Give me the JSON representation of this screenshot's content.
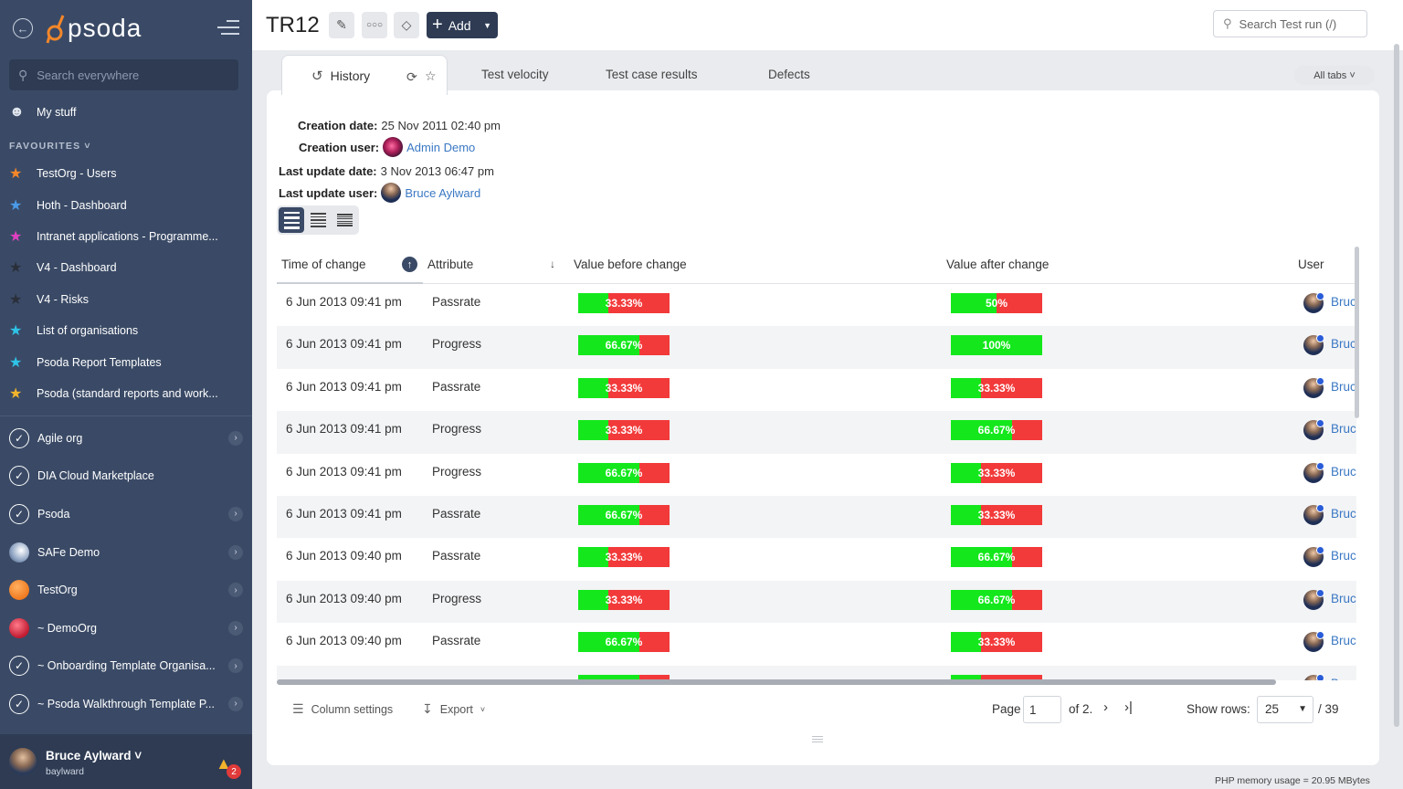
{
  "sidebar": {
    "logo_text": "psoda",
    "search_placeholder": "Search everywhere",
    "my_stuff": "My stuff",
    "favourites_heading": "FAVOURITES",
    "favourites": [
      {
        "label": "TestOrg - Users",
        "color": "#f5872a"
      },
      {
        "label": "Hoth - Dashboard",
        "color": "#4a9ae8"
      },
      {
        "label": "Intranet applications - Programme...",
        "color": "#e040c0"
      },
      {
        "label": "V4 - Dashboard",
        "color": "#2a2f3a"
      },
      {
        "label": "V4 - Risks",
        "color": "#2a2f3a"
      },
      {
        "label": "List of organisations",
        "color": "#2ec4e8"
      },
      {
        "label": "Psoda Report Templates",
        "color": "#2ec4e8"
      },
      {
        "label": "Psoda (standard reports and work...",
        "color": "#f2b42c"
      }
    ],
    "orgs": [
      {
        "label": "Agile org",
        "icon": "check",
        "arrow": true
      },
      {
        "label": "DIA Cloud Marketplace",
        "icon": "check",
        "arrow": false
      },
      {
        "label": "Psoda",
        "icon": "check",
        "arrow": true
      },
      {
        "label": "SAFe Demo",
        "icon": "safe",
        "arrow": true
      },
      {
        "label": "TestOrg",
        "icon": "orange",
        "arrow": true
      },
      {
        "label": "~ DemoOrg",
        "icon": "red",
        "arrow": true
      },
      {
        "label": "~ Onboarding Template Organisa...",
        "icon": "check",
        "arrow": true
      },
      {
        "label": "~ Psoda Walkthrough Template P...",
        "icon": "check",
        "arrow": true
      }
    ],
    "user": {
      "name": "Bruce Aylward",
      "username": "baylward",
      "notifications": "2"
    }
  },
  "header": {
    "title": "TR12",
    "add_label": "Add",
    "search_placeholder": "Search Test run (/)"
  },
  "tabs": {
    "active": "History",
    "others": [
      "Test velocity",
      "Test case results",
      "Defects"
    ],
    "all_tabs": "All tabs"
  },
  "meta": {
    "creation_date_label": "Creation date:",
    "creation_date": "25 Nov 2011 02:40 pm",
    "creation_user_label": "Creation user:",
    "creation_user": "Admin Demo",
    "last_update_date_label": "Last update date:",
    "last_update_date": "3 Nov 2013 06:47 pm",
    "last_update_user_label": "Last update user:",
    "last_update_user": "Bruce Aylward"
  },
  "table": {
    "columns": [
      "Time of change",
      "Attribute",
      "Value before change",
      "Value after change",
      "User"
    ],
    "user_display": "Bruc",
    "rows": [
      {
        "time": "6 Jun 2013 09:41 pm",
        "attribute": "Passrate",
        "before": 33.33,
        "before_label": "33.33%",
        "after": 50,
        "after_label": "50%"
      },
      {
        "time": "6 Jun 2013 09:41 pm",
        "attribute": "Progress",
        "before": 66.67,
        "before_label": "66.67%",
        "after": 100,
        "after_label": "100%"
      },
      {
        "time": "6 Jun 2013 09:41 pm",
        "attribute": "Passrate",
        "before": 33.33,
        "before_label": "33.33%",
        "after": 33.33,
        "after_label": "33.33%"
      },
      {
        "time": "6 Jun 2013 09:41 pm",
        "attribute": "Progress",
        "before": 33.33,
        "before_label": "33.33%",
        "after": 66.67,
        "after_label": "66.67%"
      },
      {
        "time": "6 Jun 2013 09:41 pm",
        "attribute": "Progress",
        "before": 66.67,
        "before_label": "66.67%",
        "after": 33.33,
        "after_label": "33.33%"
      },
      {
        "time": "6 Jun 2013 09:41 pm",
        "attribute": "Passrate",
        "before": 66.67,
        "before_label": "66.67%",
        "after": 33.33,
        "after_label": "33.33%"
      },
      {
        "time": "6 Jun 2013 09:40 pm",
        "attribute": "Passrate",
        "before": 33.33,
        "before_label": "33.33%",
        "after": 66.67,
        "after_label": "66.67%"
      },
      {
        "time": "6 Jun 2013 09:40 pm",
        "attribute": "Progress",
        "before": 33.33,
        "before_label": "33.33%",
        "after": 66.67,
        "after_label": "66.67%"
      },
      {
        "time": "6 Jun 2013 09:40 pm",
        "attribute": "Passrate",
        "before": 66.67,
        "before_label": "66.67%",
        "after": 33.33,
        "after_label": "33.33%"
      },
      {
        "time": "",
        "attribute": "",
        "before": 66.67,
        "before_label": "",
        "after": 33.33,
        "after_label": ""
      }
    ]
  },
  "footer": {
    "column_settings": "Column settings",
    "export": "Export",
    "page_label": "Page",
    "page_value": "1",
    "page_of": "of 2.",
    "show_rows_label": "Show rows:",
    "rows_value": "25",
    "total": "/ 39"
  },
  "memory": "PHP memory usage = 20.95 MBytes",
  "colors": {
    "sidebar": "#3a4a66",
    "bar_fill": "#14e81c",
    "bar_empty": "#f23a3a",
    "link": "#3a78c3"
  }
}
